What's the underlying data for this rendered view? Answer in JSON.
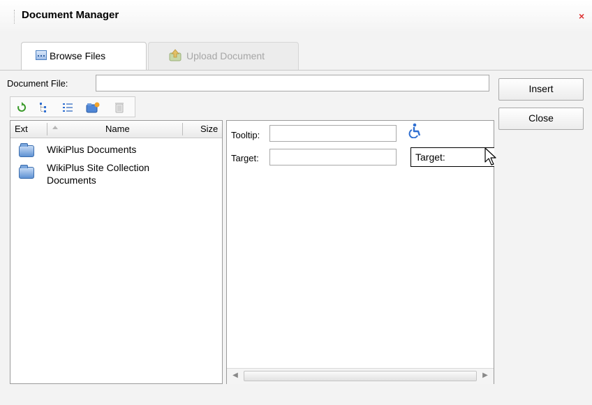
{
  "dialog": {
    "title": "Document Manager",
    "close_glyph": "×"
  },
  "tabs": [
    {
      "label": "Browse Files",
      "icon": "browse-files-icon",
      "active": true
    },
    {
      "label": "Upload Document",
      "icon": "upload-document-icon",
      "active": false
    }
  ],
  "document_file": {
    "label": "Document File:",
    "value": ""
  },
  "buttons": {
    "insert": "Insert",
    "close": "Close"
  },
  "toolbar": {
    "icons": [
      "refresh-icon",
      "tree-view-icon",
      "list-view-icon",
      "new-folder-icon",
      "delete-icon"
    ]
  },
  "file_list": {
    "columns": {
      "ext": "Ext",
      "name": "Name",
      "size": "Size"
    },
    "rows": [
      {
        "name": "WikiPlus Documents",
        "type": "folder"
      },
      {
        "name_line1": "WikiPlus Site Collection",
        "name_line2": "Documents",
        "type": "folder"
      }
    ]
  },
  "properties": {
    "tooltip_label": "Tooltip:",
    "tooltip_value": "",
    "target_label": "Target:",
    "target_value": "",
    "target_dropdown": "Target:"
  },
  "colors": {
    "close_x": "#dd3333",
    "accent_blue": "#2f6fd1"
  }
}
